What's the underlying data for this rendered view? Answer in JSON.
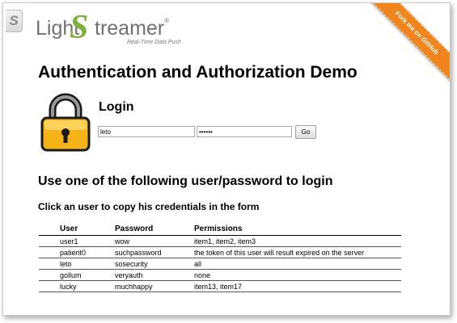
{
  "logo": {
    "word_before": "Light",
    "big_letter": "S",
    "word_after": "treamer",
    "reg_mark": "®",
    "tagline": "Real-Time Data Push"
  },
  "ribbon": {
    "label": "Fork me on GitHub"
  },
  "page": {
    "title": "Authentication and Authorization Demo"
  },
  "login": {
    "title": "Login",
    "username_value": "leto",
    "password_value": "secret",
    "go_label": "Go"
  },
  "instructions": {
    "heading": "Use one of the following user/password to login",
    "subheading": "Click an user to copy his credentials in the form"
  },
  "users_table": {
    "headers": [
      "User",
      "Password",
      "Permissions"
    ],
    "rows": [
      [
        "user1",
        "wow",
        "item1, item2, item3"
      ],
      [
        "patient0",
        "suchpassword",
        "the token of this user will result expired on the server"
      ],
      [
        "leto",
        "sosecurity",
        "all"
      ],
      [
        "gollum",
        "veryauth",
        "none"
      ],
      [
        "lucky",
        "muchhappy",
        "item13, item17"
      ]
    ]
  },
  "colors": {
    "ribbon": "#f0851d",
    "logo_green": "#7fb03a",
    "lock_gold": "#f6b318"
  },
  "icons": {
    "side_tab": "s-tab-icon",
    "lock": "padlock-icon"
  }
}
